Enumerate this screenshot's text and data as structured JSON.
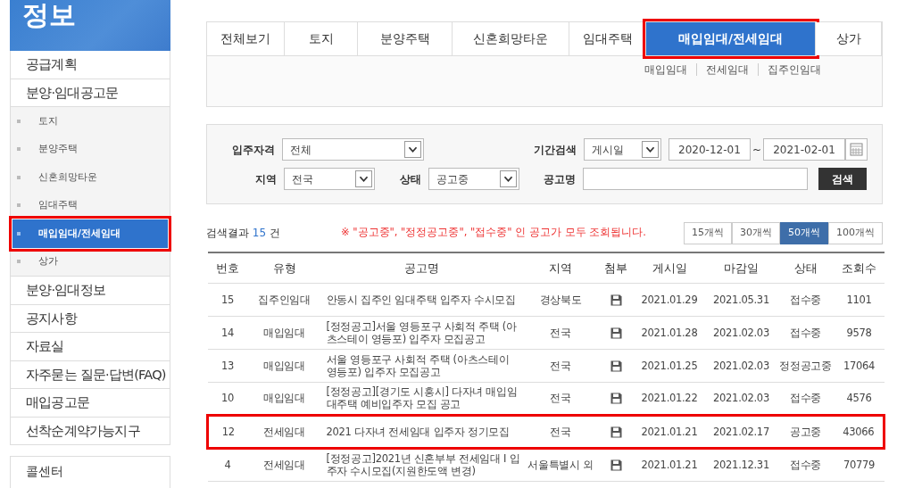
{
  "sidebar": {
    "title": "정보",
    "items": [
      {
        "label": "공급계획",
        "selected": false,
        "highlighted": false
      },
      {
        "label": "분양·임대공고문",
        "selected": false,
        "highlighted": false,
        "children": [
          {
            "label": "토지",
            "selected": false,
            "highlighted": false
          },
          {
            "label": "분양주택",
            "selected": false,
            "highlighted": false
          },
          {
            "label": "신혼희망타운",
            "selected": false,
            "highlighted": false
          },
          {
            "label": "임대주택",
            "selected": false,
            "highlighted": false
          },
          {
            "label": "매입임대/전세임대",
            "selected": true,
            "highlighted": true
          },
          {
            "label": "상가",
            "selected": false,
            "highlighted": false
          }
        ]
      },
      {
        "label": "분양·임대정보",
        "selected": false,
        "highlighted": false
      },
      {
        "label": "공지사항",
        "selected": false,
        "highlighted": false
      },
      {
        "label": "자료실",
        "selected": false,
        "highlighted": false
      },
      {
        "label": "자주묻는 질문·답변(FAQ)",
        "selected": false,
        "highlighted": false
      },
      {
        "label": "매입공고문",
        "selected": false,
        "highlighted": false
      },
      {
        "label": "선착순계약가능지구",
        "selected": false,
        "highlighted": false
      }
    ],
    "box_title": "콜센터"
  },
  "tabs": [
    {
      "label": "전체보기",
      "selected": false,
      "highlighted": false
    },
    {
      "label": "토지",
      "selected": false,
      "highlighted": false
    },
    {
      "label": "분양주택",
      "selected": false,
      "highlighted": false
    },
    {
      "label": "신혼희망타운",
      "selected": false,
      "highlighted": false
    },
    {
      "label": "임대주택",
      "selected": false,
      "highlighted": false
    },
    {
      "label": "매입임대/전세임대",
      "selected": true,
      "highlighted": true
    },
    {
      "label": "상가",
      "selected": false,
      "highlighted": false
    }
  ],
  "subtabs": [
    "매입임대",
    "전세임대",
    "집주인임대"
  ],
  "search": {
    "qualification_label": "입주자격",
    "qualification": "전체",
    "period_label": "기간검색",
    "period_type": "게시일",
    "date_from": "2020-12-01",
    "date_sep": "~",
    "date_to": "2021-02-01",
    "region_label": "지역",
    "region": "전국",
    "status_label": "상태",
    "status": "공고중",
    "name_label": "공고명",
    "button": "검색"
  },
  "results": {
    "prefix": "검색결과",
    "count": "15",
    "suffix": "건",
    "notice": "※ \"공고중\", \"정정공고중\", \"접수중\" 인 공고가 모두 조회됩니다.",
    "page_sizes": [
      {
        "label": "15개씩",
        "selected": false
      },
      {
        "label": "30개씩",
        "selected": false
      },
      {
        "label": "50개씩",
        "selected": true
      },
      {
        "label": "100개씩",
        "selected": false
      }
    ]
  },
  "table": {
    "columns": [
      "번호",
      "유형",
      "공고명",
      "지역",
      "첨부",
      "게시일",
      "마감일",
      "상태",
      "조회수"
    ],
    "rows": [
      {
        "no": "15",
        "type": "집주인임대",
        "title": "안동시 집주인 임대주택 입주자 수시모집",
        "region": "경상북도",
        "posted": "2021.01.29",
        "deadline": "2021.05.31",
        "status": "접수중",
        "views": "1101",
        "highlighted": false
      },
      {
        "no": "14",
        "type": "매입임대",
        "title": "[정정공고]서울 영등포구 사회적 주택 (아츠스테이 영등포) 입주자 모집공고",
        "region": "전국",
        "posted": "2021.01.28",
        "deadline": "2021.02.03",
        "status": "접수중",
        "views": "9578",
        "highlighted": false
      },
      {
        "no": "13",
        "type": "매입임대",
        "title": "서울 영등포구 사회적 주택 (아츠스테이 영등포) 입주자 모집공고",
        "region": "전국",
        "posted": "2021.01.25",
        "deadline": "2021.02.03",
        "status": "정정공고중",
        "views": "17064",
        "highlighted": false
      },
      {
        "no": "10",
        "type": "매입임대",
        "title": "[정정공고][경기도 시흥시] 다자녀 매입임대주택 예비입주자 모집 공고",
        "region": "전국",
        "posted": "2021.01.22",
        "deadline": "2021.02.03",
        "status": "접수중",
        "views": "4576",
        "highlighted": false
      },
      {
        "no": "12",
        "type": "전세임대",
        "title": "2021 다자녀 전세임대 입주자 정기모집",
        "region": "전국",
        "posted": "2021.01.21",
        "deadline": "2021.02.17",
        "status": "공고중",
        "views": "43066",
        "highlighted": true
      },
      {
        "no": "4",
        "type": "전세임대",
        "title": "[정정공고]2021년 신혼부부 전세임대 I 입주자 수시모집(지원한도액 변경)",
        "region": "서울특별시 외",
        "posted": "2021.01.21",
        "deadline": "2021.12.31",
        "status": "접수중",
        "views": "70779",
        "highlighted": false
      }
    ]
  }
}
